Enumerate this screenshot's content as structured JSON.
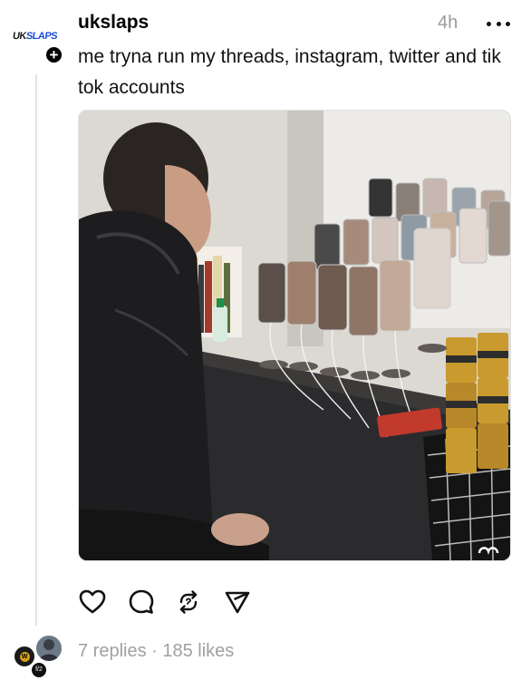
{
  "post": {
    "username": "ukslaps",
    "timestamp": "4h",
    "caption": "me tryna run my threads, instagram, twitter and tik tok accounts",
    "avatar_logo": {
      "text": "UKSLAPS",
      "icon": "ukslaps-logo"
    },
    "follow_icon": "plus-icon",
    "more_icon": "more-horizontal-icon",
    "media": {
      "type": "photo",
      "icon": "photo-image"
    }
  },
  "actions": [
    {
      "name": "like",
      "icon": "heart-icon"
    },
    {
      "name": "reply",
      "icon": "comment-icon"
    },
    {
      "name": "repost",
      "icon": "repost-icon"
    },
    {
      "name": "share",
      "icon": "send-icon"
    }
  ],
  "footer": {
    "replies": "7 replies",
    "separator": "·",
    "likes": "185 likes",
    "stats_text": "7 replies · 185 likes"
  },
  "colors": {
    "text": "#000000",
    "muted": "#9a9a9a",
    "thread_line": "#e3e3e3",
    "logo_accent": "#1d4ed8"
  }
}
